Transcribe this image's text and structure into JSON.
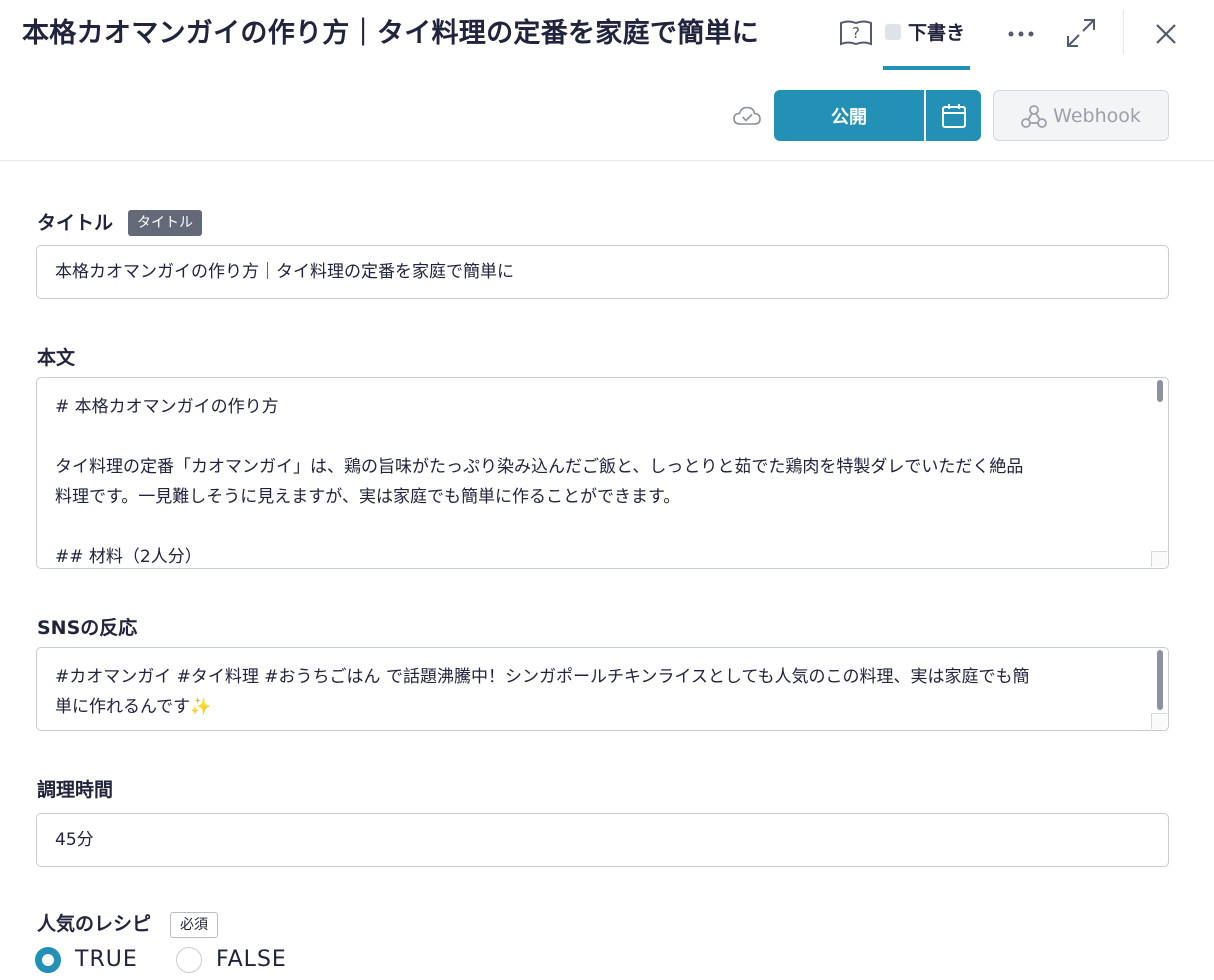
{
  "header": {
    "title": "本格カオマンガイの作り方｜タイ料理の定番を家庭で簡単に",
    "status_label": "下書き",
    "publish_label": "公開",
    "webhook_label": "Webhook",
    "icons": {
      "help": "help-book-icon",
      "more": "more-horizontal-icon",
      "expand": "expand-icon",
      "close": "close-icon",
      "saved": "cloud-check-icon",
      "schedule": "calendar-icon",
      "webhook": "webhook-icon"
    },
    "accent_color": "#2391b6"
  },
  "form": {
    "title_field": {
      "label": "タイトル",
      "badge": "タイトル",
      "value": "本格カオマンガイの作り方｜タイ料理の定番を家庭で簡単に"
    },
    "body_field": {
      "label": "本文",
      "lines": [
        "# 本格カオマンガイの作り方",
        "",
        "タイ料理の定番「カオマンガイ」は、鶏の旨味がたっぷり染み込んだご飯と、しっとりと茹でた鶏肉を特製ダレでいただく絶品",
        "料理です。一見難しそうに見えますが、実は家庭でも簡単に作ることができます。",
        "",
        "## 材料（2人分）"
      ]
    },
    "sns_field": {
      "label": "SNSの反応",
      "lines": [
        "#カオマンガイ #タイ料理 #おうちごはん で話題沸騰中！シンガポールチキンライスとしても人気のこの料理、実は家庭でも簡",
        "単に作れるんです✨"
      ]
    },
    "cook_time_field": {
      "label": "調理時間",
      "value": "45分"
    },
    "popular_field": {
      "label": "人気のレシピ",
      "badge": "必須",
      "options": [
        "TRUE",
        "FALSE"
      ],
      "selected": "TRUE"
    }
  }
}
